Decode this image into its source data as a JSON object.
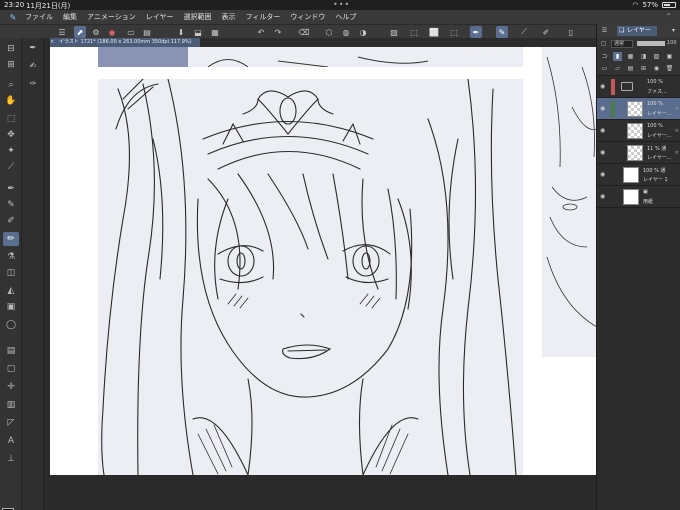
{
  "status": {
    "time": "23:20",
    "date": "11月21日(月)",
    "battery": "57%"
  },
  "menu": {
    "items": [
      "ファイル",
      "編集",
      "アニメーション",
      "レイヤー",
      "選択範囲",
      "表示",
      "フィルター",
      "ウィンドウ",
      "ヘルプ"
    ]
  },
  "document": {
    "tab_title": "イラスト 1721* (186.00 x 263.00mm 350dpi 117.9%)"
  },
  "layers": {
    "tab_label": "レイヤー",
    "blend_mode": "通常",
    "opacity": "100",
    "rows": [
      {
        "pct": "100 %",
        "name": "ファス..."
      },
      {
        "pct": "100 %",
        "name": "レイヤー..."
      },
      {
        "pct": "100 %",
        "name": "レイヤー..."
      },
      {
        "pct": "11 % 通",
        "name": "レイヤー..."
      },
      {
        "pct": "100 % 通",
        "name": "レイヤー 1"
      },
      {
        "pct": "",
        "name": "用紙"
      }
    ]
  },
  "colors": {
    "accent": "#5a6f90",
    "panel": "#2e2e2e",
    "canvas": "#edeef4"
  }
}
